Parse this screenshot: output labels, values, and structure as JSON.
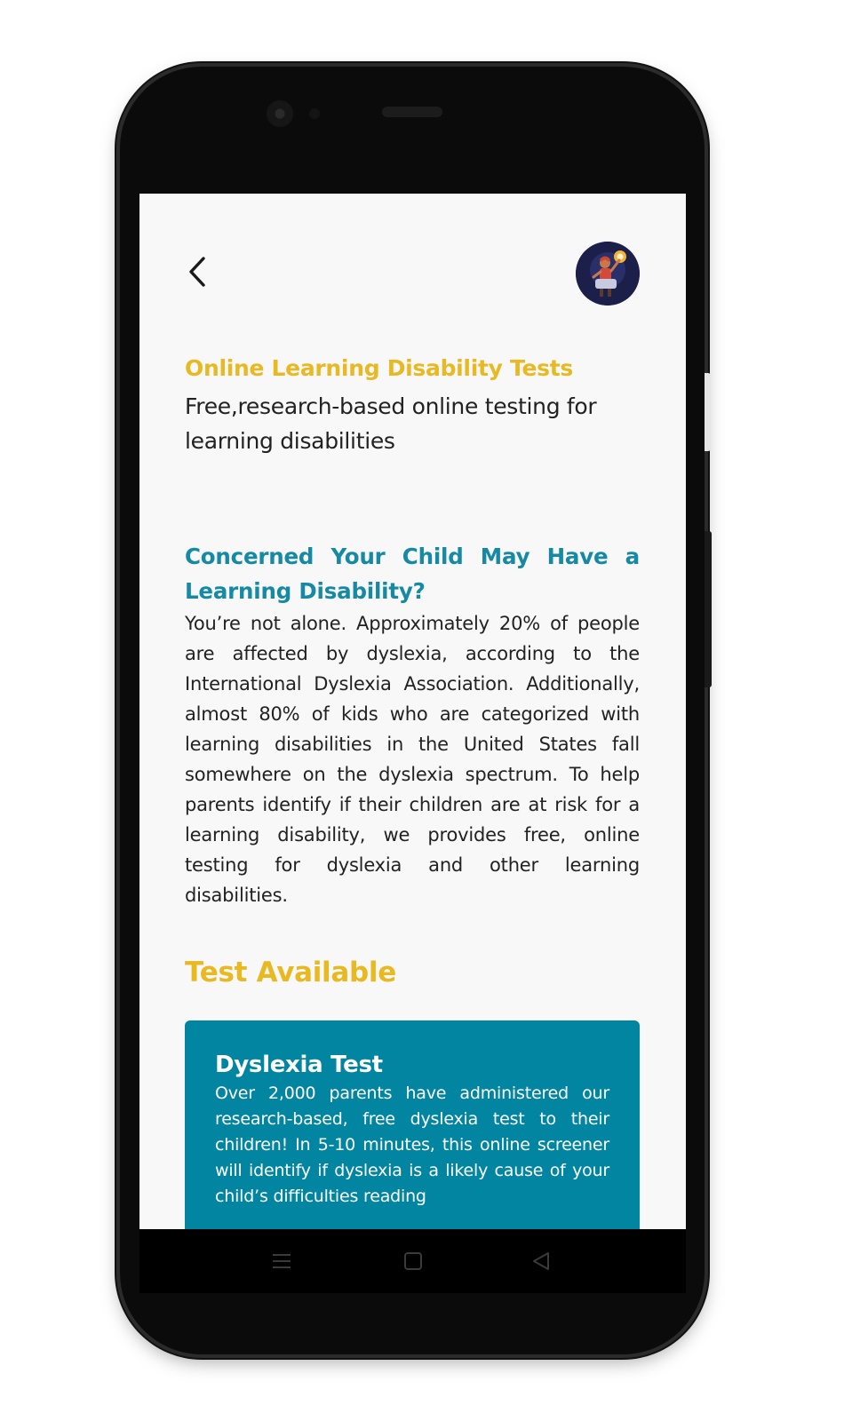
{
  "header": {
    "back_icon": "chevron-left-icon",
    "avatar_icon": "avatar"
  },
  "intro": {
    "title": "Online Learning Disability Tests",
    "subtitle": "Free,research-based online testing for learning disabilities"
  },
  "concern": {
    "heading": "Concerned Your Child May Have a Learning Disability?",
    "body": "You’re not alone. Approximately 20% of people are affected by dyslexia, according to the International Dyslexia Association. Additionally, almost 80% of kids who are categorized with learning disabilities in the United States fall somewhere on the dyslexia spectrum. To help parents identify if their children are at risk for a learning disability, we provides free, online testing for dyslexia and other learning disabilities."
  },
  "tests": {
    "heading": "Test Available",
    "items": [
      {
        "title": "Dyslexia Test",
        "description": "Over 2,000 parents have administered our research-based, free dyslexia test to their children! In 5-10 minutes, this online screener will identify if dyslexia is a likely cause of your child’s difficulties reading"
      }
    ]
  },
  "colors": {
    "accent_yellow": "#e8b923",
    "accent_teal": "#1689a5",
    "card_background": "#0285a1"
  },
  "system_nav": {
    "menu_icon": "menu-icon",
    "home_icon": "home-square-icon",
    "back_icon": "back-triangle-icon"
  }
}
